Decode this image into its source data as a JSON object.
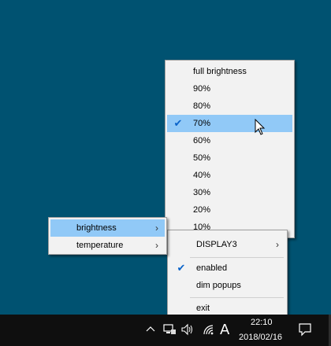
{
  "context_menu": {
    "items": [
      {
        "label": "DISPLAY3",
        "checked": false,
        "submenu": true
      },
      {
        "label": "enabled",
        "checked": true,
        "submenu": false
      },
      {
        "label": "dim popups",
        "checked": false,
        "submenu": false
      },
      {
        "label": "exit",
        "checked": false,
        "submenu": false
      }
    ]
  },
  "display_submenu": {
    "items": [
      {
        "label": "brightness",
        "highlighted": true,
        "submenu": true
      },
      {
        "label": "temperature",
        "highlighted": false,
        "submenu": true
      }
    ]
  },
  "brightness_menu": {
    "selected": "70%",
    "items": [
      "full brightness",
      "90%",
      "80%",
      "70%",
      "60%",
      "50%",
      "40%",
      "30%",
      "20%",
      "10%"
    ]
  },
  "taskbar": {
    "time": "22:10",
    "date": "2018/02/16",
    "ime_indicator": "A",
    "tray_icons": [
      "chevron-up-icon",
      "network-icon",
      "volume-icon",
      "wifi-icon",
      "ime-icon",
      "notification-icon"
    ]
  },
  "colors": {
    "desktop": "#005271",
    "menu_bg": "#f2f2f2",
    "highlight": "#91c9f7",
    "taskbar": "#0f0f0f"
  },
  "glyphs": {
    "check": "✔",
    "arrow": "›"
  }
}
